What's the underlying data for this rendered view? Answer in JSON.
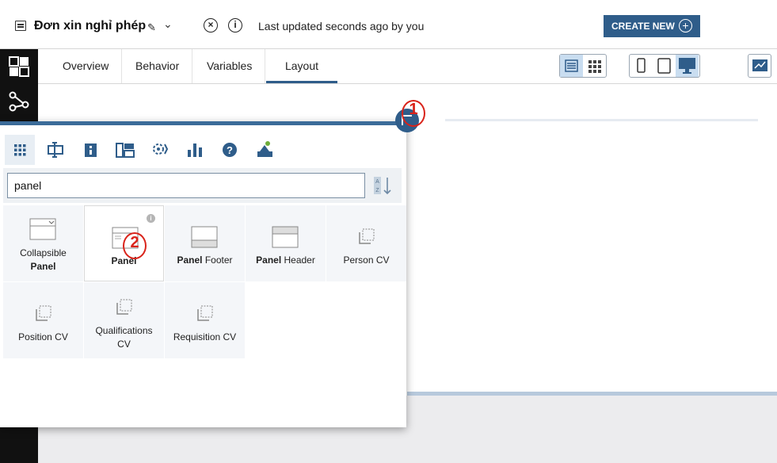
{
  "header": {
    "title": "Đơn xin nghỉ phép",
    "updated_text": "Last updated seconds ago by you",
    "create_label": "CREATE NEW",
    "create_icon": "plus-circle-icon"
  },
  "tabs": [
    {
      "label": "Overview"
    },
    {
      "label": "Behavior"
    },
    {
      "label": "Variables"
    },
    {
      "label": "Layout",
      "active": true
    }
  ],
  "palette": {
    "search_value": "panel",
    "tabs": [
      "grid-icon",
      "input-icon",
      "info-icon",
      "layout-icon",
      "gears-icon",
      "chart-icon",
      "help-icon",
      "custom-icon"
    ],
    "items": [
      {
        "pre": "Collapsible",
        "bold": "Panel",
        "post": ""
      },
      {
        "pre": "",
        "bold": "Panel",
        "post": ""
      },
      {
        "pre": "",
        "bold": "Panel",
        "post": " Footer"
      },
      {
        "pre": "",
        "bold": "Panel",
        "post": " Header"
      },
      {
        "pre": "Person CV",
        "bold": "",
        "post": ""
      },
      {
        "pre": "Position CV",
        "bold": "",
        "post": ""
      },
      {
        "pre": "Qualifications CV",
        "bold": "",
        "post": ""
      },
      {
        "pre": "Requisition CV",
        "bold": "",
        "post": ""
      }
    ]
  },
  "annotations": {
    "marker1": "1",
    "marker2": "2"
  },
  "colors": {
    "accent": "#2f5d8a",
    "marker": "#d9231a",
    "rail": "#111111"
  }
}
